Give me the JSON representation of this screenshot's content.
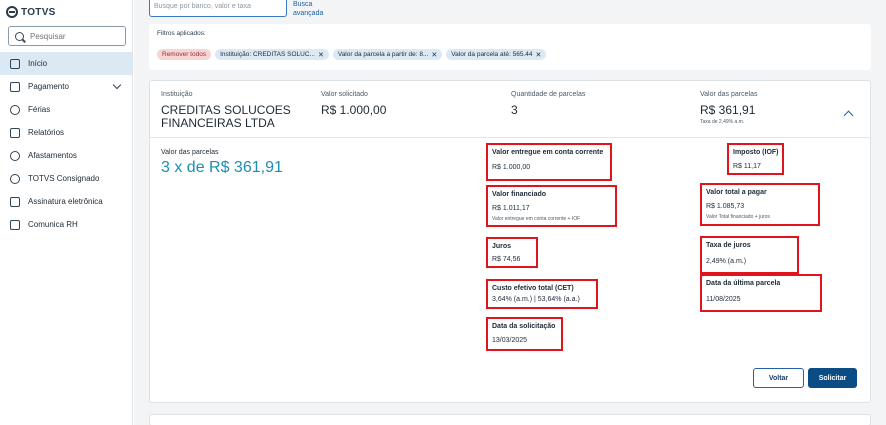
{
  "sidebar": {
    "logo": "TOTVS",
    "search_placeholder": "Pesquisar",
    "items": [
      {
        "label": "Início",
        "icon": "home-icon"
      },
      {
        "label": "Pagamento",
        "icon": "payment-icon"
      },
      {
        "label": "Férias",
        "icon": "sun-icon"
      },
      {
        "label": "Relatórios",
        "icon": "report-icon"
      },
      {
        "label": "Afastamentos",
        "icon": "leave-icon"
      },
      {
        "label": "TOTVS Consignado",
        "icon": "consignado-icon"
      },
      {
        "label": "Assinatura eletrônica",
        "icon": "signature-icon"
      },
      {
        "label": "Comunica RH",
        "icon": "chat-icon"
      }
    ]
  },
  "top": {
    "search_placeholder": "Busque por banco, valor e taxa",
    "advanced_line1": "Busca",
    "advanced_line2": "avançada"
  },
  "filters": {
    "title": "Filtros aplicados:",
    "remove_all": "Remover todos",
    "chips": [
      "Instituição: CREDITAS SOLUC...",
      "Valor da parcela a partir de: 8...",
      "Valor da parcela até: 565.44"
    ]
  },
  "offer": {
    "institution_label": "Instituição",
    "institution_name": "CREDITAS SOLUCOES FINANCEIRAS LTDA",
    "requested_label": "Valor solicitado",
    "requested_value": "R$ 1.000,00",
    "installments_label": "Quantidade de parcelas",
    "installments_value": "3",
    "installment_value_label": "Valor das parcelas",
    "installment_value": "R$ 361,91",
    "rate_note": "Taxa de 2,49% a.m.",
    "detail_label": "Valor das parcelas",
    "detail_value": "3 x de R$ 361,91"
  },
  "details": {
    "valor_entregue": {
      "label": "Valor entregue em conta corrente",
      "value": "R$ 1.000,00"
    },
    "iof": {
      "label": "Imposto (IOF)",
      "value": "R$ 11,17"
    },
    "financiado": {
      "label": "Valor financiado",
      "value": "R$ 1.011,17",
      "sub": "Valor entregue em conta corrente + IOF"
    },
    "total": {
      "label": "Valor total a pagar",
      "value": "R$ 1.085,73",
      "sub": "Valor Total financiado + juros"
    },
    "juros": {
      "label": "Juros",
      "value": "R$ 74,56"
    },
    "taxa": {
      "label": "Taxa de juros",
      "value": "2,49% (a.m.)"
    },
    "cet": {
      "label": "Custo efetivo total (CET)",
      "value": "3,64% (a.m.) | 53,64% (a.a.)"
    },
    "ultima": {
      "label": "Data da última parcela",
      "value": "11/08/2025"
    },
    "solicitacao": {
      "label": "Data da solicitação",
      "value": "13/03/2025"
    }
  },
  "actions": {
    "back": "Voltar",
    "request": "Solicitar"
  },
  "colors": {
    "highlight_border": "#e0141c",
    "primary": "#0c4c84",
    "accent_value": "#1b8fb2",
    "active_nav": "#dbe9f5"
  }
}
